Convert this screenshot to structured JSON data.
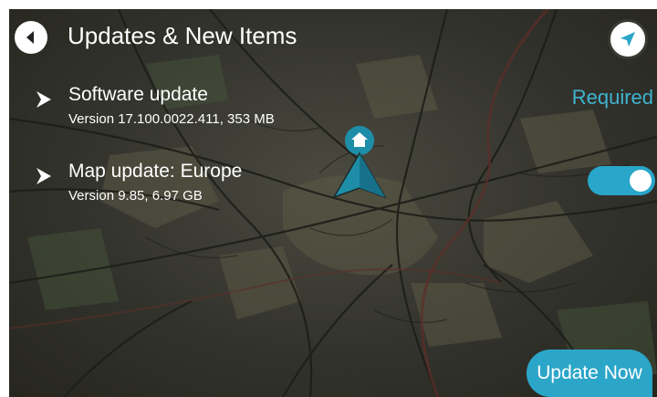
{
  "header": {
    "title": "Updates & New Items",
    "back_icon": "back-arrow-icon",
    "nav_icon": "navigation-arrow-icon"
  },
  "items": [
    {
      "name": "Software update",
      "detail": "Version 17.100.0022.411, 353 MB",
      "status": "Required"
    },
    {
      "name": "Map update: Europe",
      "detail": "Version 9.85, 6.97 GB",
      "toggle_on": true
    }
  ],
  "update_button": {
    "label": "Update Now"
  },
  "colors": {
    "accent": "#2ba6c8",
    "status_text": "#3fb4d2",
    "map_background": "#33332d",
    "map_marker": "#1e8ea8"
  },
  "icons": {
    "item_expand": "chevron-right-icon",
    "map_home": "home-pin-icon",
    "map_position": "current-position-arrow-icon"
  }
}
